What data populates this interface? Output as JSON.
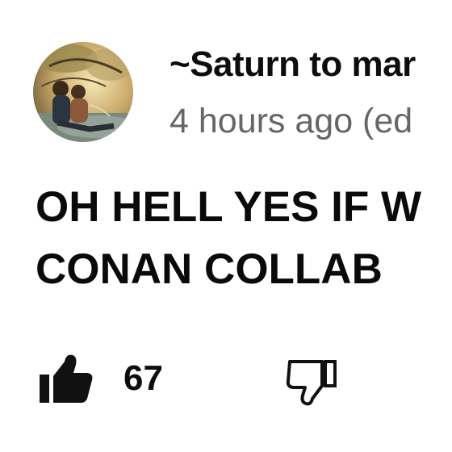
{
  "comment": {
    "author": "~Saturn to mar",
    "timestamp": "4 hours ago (ed",
    "text_lines": [
      "OH HELL YES IF W",
      "CONAN COLLAB"
    ]
  },
  "actions": {
    "like_count": "67",
    "like_icon": "thumbs-up-icon",
    "dislike_icon": "thumbs-down-icon"
  },
  "colors": {
    "text": "#0d0d0d",
    "timestamp": "#666666",
    "background": "#ffffff"
  }
}
